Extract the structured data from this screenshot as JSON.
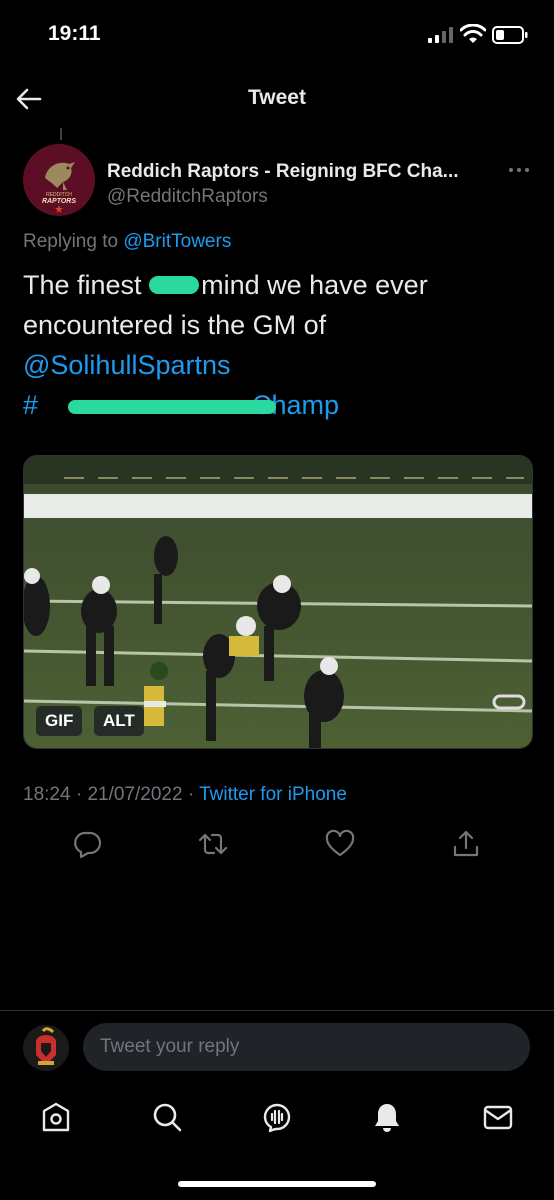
{
  "status_bar": {
    "time": "19:11",
    "icons": [
      "cellular-signal-icon",
      "wifi-icon",
      "battery-icon"
    ]
  },
  "header": {
    "title": "Tweet",
    "back_icon": "arrow-left-icon"
  },
  "tweet": {
    "display_name": "Reddich Raptors - Reigning BFC Cha...",
    "handle": "@RedditchRaptors",
    "avatar_text_top": "REDDITCH",
    "avatar_text_bottom": "RAPTORS",
    "replying_prefix": "Replying to",
    "replying_to": "@BritTowers",
    "body_line1_a": "The finest",
    "body_line1_b": "mind we have ever",
    "body_line2": "encountered is the GM of",
    "mention": "@SolihullSpartns",
    "hashtag_start": "#",
    "hashtag_end": "Champ",
    "media": {
      "gif_label": "GIF",
      "alt_label": "ALT"
    },
    "time": "18:24",
    "separator": "·",
    "date": "21/07/2022",
    "source": "Twitter for iPhone"
  },
  "actions": [
    "reply-icon",
    "retweet-icon",
    "like-icon",
    "share-icon"
  ],
  "reply_bar": {
    "placeholder": "Tweet your reply"
  },
  "bottom_nav": [
    "home-icon",
    "search-icon",
    "spaces-icon",
    "notifications-icon",
    "messages-icon"
  ],
  "colors": {
    "background": "#000000",
    "accent": "#1d9bf0",
    "text_primary": "#e7e9ea",
    "text_secondary": "#71767b",
    "redaction": "#2ad8a0"
  }
}
